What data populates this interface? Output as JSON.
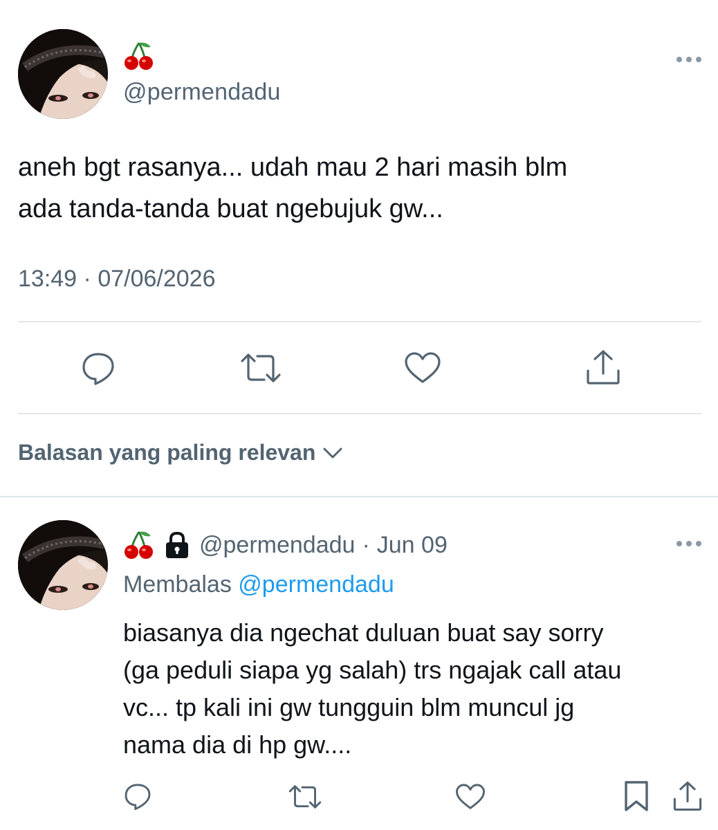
{
  "tweet": {
    "emoji": "🍒",
    "handle": "@permendadu",
    "text_lines": [
      "aneh bgt rasanya... udah mau 2 hari masih blm",
      "ada tanda-tanda buat ngebujuk gw..."
    ],
    "time": "13:49",
    "date_sep": "·",
    "date": "07/06/2026"
  },
  "sort": {
    "label": "Balasan yang paling relevan"
  },
  "reply": {
    "emoji": "🍒",
    "handle": "@permendadu",
    "sep": "·",
    "date": "Jun 09",
    "replying_prefix": "Membalas",
    "replying_mention": "@permendadu",
    "text_lines": [
      "biasanya dia ngechat duluan buat say sorry",
      "(ga peduli siapa yg salah) trs ngajak call atau",
      "vc... tp kali ini gw tungguin blm muncul jg",
      "nama dia di hp gw...."
    ]
  },
  "icons": {
    "more": "more-horizontal-icon",
    "reply": "reply-icon",
    "retweet": "retweet-icon",
    "like": "heart-icon",
    "share": "share-icon",
    "bookmark": "bookmark-icon",
    "lock": "lock-icon",
    "cherry": "cherry-emoji-icon",
    "chevron": "chevron-down-icon"
  },
  "colors": {
    "text": "#0f1419",
    "secondary": "#536471",
    "link": "#1d9bf0",
    "divider": "#e1e6ea",
    "icon": "#536471"
  }
}
